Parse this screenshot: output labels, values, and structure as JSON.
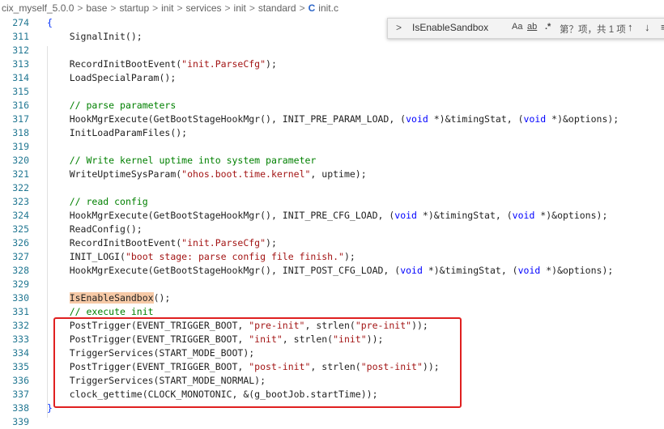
{
  "breadcrumb": {
    "items": [
      "cix_myself_5.0.0",
      "base",
      "startup",
      "init",
      "services",
      "init",
      "standard"
    ],
    "file_icon": "C",
    "file": "init.c",
    "separator": ">"
  },
  "find": {
    "toggle_glyph": ">",
    "query": "IsEnableSandbox",
    "match_case": "Aa",
    "whole_word": "ab",
    "regex": ".*",
    "count": "第？项，共 1 项",
    "prev_glyph": "↑",
    "next_glyph": "↓",
    "more_glyph": "≡"
  },
  "lines": [
    {
      "n": "274",
      "t": "{"
    },
    {
      "n": "311",
      "t": "    SignalInit();"
    },
    {
      "n": "312",
      "t": ""
    },
    {
      "n": "313",
      "t": "    RecordInitBootEvent(\"init.ParseCfg\");"
    },
    {
      "n": "314",
      "t": "    LoadSpecialParam();"
    },
    {
      "n": "315",
      "t": ""
    },
    {
      "n": "316",
      "t": "    // parse parameters"
    },
    {
      "n": "317",
      "t": "    HookMgrExecute(GetBootStageHookMgr(), INIT_PRE_PARAM_LOAD, (void *)&timingStat, (void *)&options);"
    },
    {
      "n": "318",
      "t": "    InitLoadParamFiles();"
    },
    {
      "n": "319",
      "t": ""
    },
    {
      "n": "320",
      "t": "    // Write kernel uptime into system parameter"
    },
    {
      "n": "321",
      "t": "    WriteUptimeSysParam(\"ohos.boot.time.kernel\", uptime);"
    },
    {
      "n": "322",
      "t": ""
    },
    {
      "n": "323",
      "t": "    // read config"
    },
    {
      "n": "324",
      "t": "    HookMgrExecute(GetBootStageHookMgr(), INIT_PRE_CFG_LOAD, (void *)&timingStat, (void *)&options);"
    },
    {
      "n": "325",
      "t": "    ReadConfig();"
    },
    {
      "n": "326",
      "t": "    RecordInitBootEvent(\"init.ParseCfg\");"
    },
    {
      "n": "327",
      "t": "    INIT_LOGI(\"boot stage: parse config file finish.\");"
    },
    {
      "n": "328",
      "t": "    HookMgrExecute(GetBootStageHookMgr(), INIT_POST_CFG_LOAD, (void *)&timingStat, (void *)&options);"
    },
    {
      "n": "329",
      "t": ""
    },
    {
      "n": "330",
      "t": "    IsEnableSandbox();"
    },
    {
      "n": "331",
      "t": "    // execute init"
    },
    {
      "n": "332",
      "t": "    PostTrigger(EVENT_TRIGGER_BOOT, \"pre-init\", strlen(\"pre-init\"));"
    },
    {
      "n": "333",
      "t": "    PostTrigger(EVENT_TRIGGER_BOOT, \"init\", strlen(\"init\"));"
    },
    {
      "n": "334",
      "t": "    TriggerServices(START_MODE_BOOT);"
    },
    {
      "n": "335",
      "t": "    PostTrigger(EVENT_TRIGGER_BOOT, \"post-init\", strlen(\"post-init\"));"
    },
    {
      "n": "336",
      "t": "    TriggerServices(START_MODE_NORMAL);"
    },
    {
      "n": "337",
      "t": "    clock_gettime(CLOCK_MONOTONIC, &(g_bootJob.startTime));"
    },
    {
      "n": "338",
      "t": "}"
    },
    {
      "n": "339",
      "t": ""
    }
  ],
  "colors": {
    "line_number": "#237893",
    "string": "#a31515",
    "keyword": "#0000ff",
    "comment": "#008000",
    "match_highlight": "#f6c9a6",
    "annotation_box": "#e02020"
  }
}
